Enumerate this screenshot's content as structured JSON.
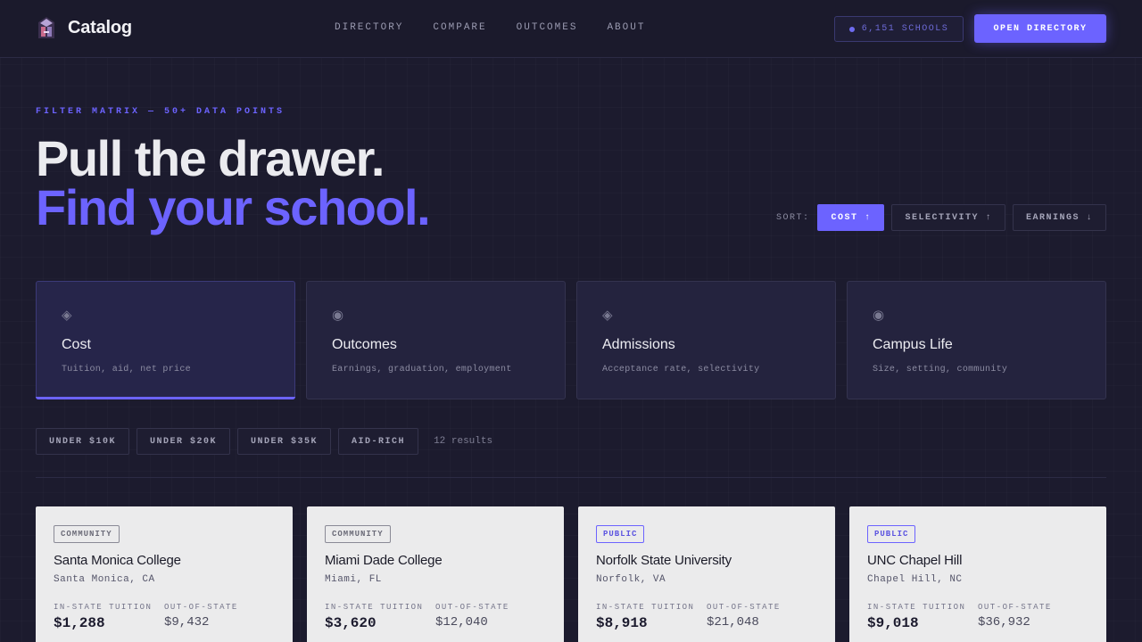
{
  "nav": {
    "brand": "Catalog",
    "links": [
      "DIRECTORY",
      "COMPARE",
      "OUTCOMES",
      "ABOUT"
    ],
    "schools_badge": "6,151 SCHOOLS",
    "cta": "OPEN DIRECTORY"
  },
  "hero": {
    "eyebrow": "FILTER MATRIX — 50+ DATA POINTS",
    "line1": "Pull the drawer.",
    "line2": "Find your school."
  },
  "sort": {
    "label": "SORT:",
    "options": [
      "COST ↑",
      "SELECTIVITY ↑",
      "EARNINGS ↓"
    ],
    "active": "COST ↑"
  },
  "categories": [
    {
      "icon": "diamond-icon",
      "glyph": "◈",
      "title": "Cost",
      "subtitle": "Tuition, aid, net price",
      "active": true
    },
    {
      "icon": "target-icon",
      "glyph": "◉",
      "title": "Outcomes",
      "subtitle": "Earnings, graduation, employment",
      "active": false
    },
    {
      "icon": "diamond-icon",
      "glyph": "◈",
      "title": "Admissions",
      "subtitle": "Acceptance rate, selectivity",
      "active": false
    },
    {
      "icon": "target-icon",
      "glyph": "◉",
      "title": "Campus Life",
      "subtitle": "Size, setting, community",
      "active": false
    }
  ],
  "filters": {
    "chips": [
      "UNDER $10K",
      "UNDER $20K",
      "UNDER $35K",
      "AID-RICH"
    ],
    "results": "12 results"
  },
  "tuition_labels": {
    "in_state": "IN-STATE TUITION",
    "out_state": "OUT-OF-STATE"
  },
  "schools": [
    {
      "type": "COMMUNITY",
      "name": "Santa Monica College",
      "location": "Santa Monica, CA",
      "in_state": "$1,288",
      "out_state": "$9,432"
    },
    {
      "type": "COMMUNITY",
      "name": "Miami Dade College",
      "location": "Miami, FL",
      "in_state": "$3,620",
      "out_state": "$12,040"
    },
    {
      "type": "PUBLIC",
      "name": "Norfolk State University",
      "location": "Norfolk, VA",
      "in_state": "$8,918",
      "out_state": "$21,048"
    },
    {
      "type": "PUBLIC",
      "name": "UNC Chapel Hill",
      "location": "Chapel Hill, NC",
      "in_state": "$9,018",
      "out_state": "$36,932"
    }
  ],
  "colors": {
    "accent": "#6c63ff",
    "background": "#1c1b2e",
    "card": "#24233e",
    "school_card": "#ebebec"
  }
}
